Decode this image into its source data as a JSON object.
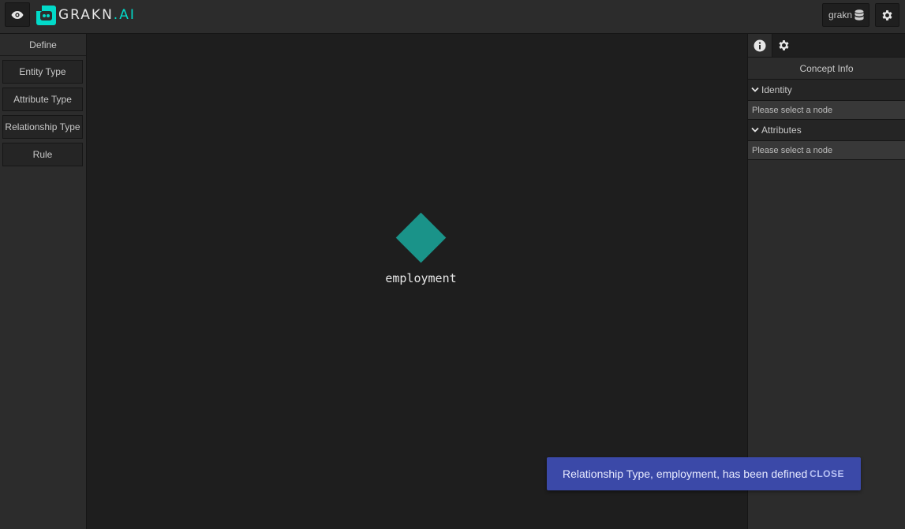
{
  "header": {
    "logo_text": "GRAKN",
    "logo_suffix": ".AI",
    "keyspace": "grakn"
  },
  "define_panel": {
    "title": "Define",
    "buttons": [
      "Entity Type",
      "Attribute Type",
      "Relationship Type",
      "Rule"
    ]
  },
  "canvas": {
    "node_label": "employment",
    "node_color": "#1a9389"
  },
  "concept_panel": {
    "title": "Concept Info",
    "sections": [
      {
        "label": "Identity",
        "body": "Please select a node"
      },
      {
        "label": "Attributes",
        "body": "Please select a node"
      }
    ]
  },
  "snackbar": {
    "message": "Relationship Type, employment, has been defined",
    "action": "CLOSE"
  },
  "colors": {
    "accent": "#02dac9",
    "snackbar": "#3b49a8"
  }
}
